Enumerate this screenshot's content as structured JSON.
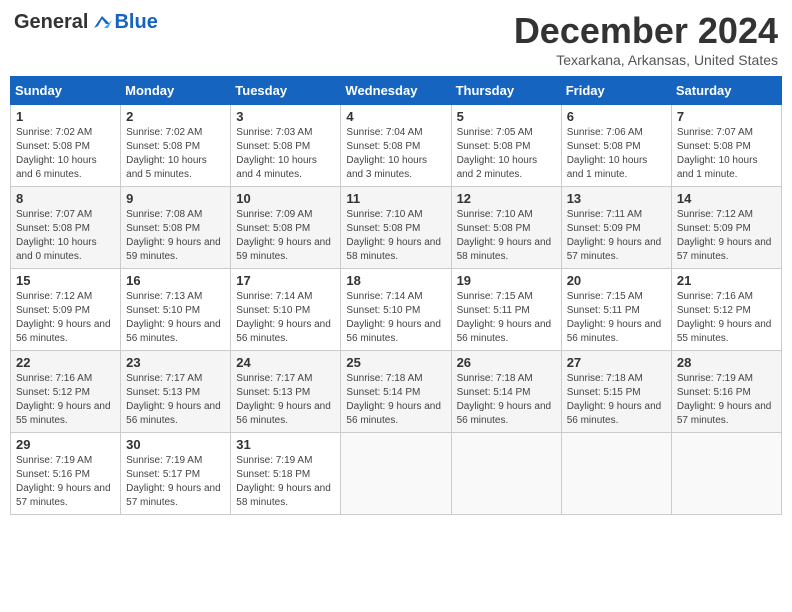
{
  "header": {
    "logo_general": "General",
    "logo_blue": "Blue",
    "title": "December 2024",
    "location": "Texarkana, Arkansas, United States"
  },
  "days_of_week": [
    "Sunday",
    "Monday",
    "Tuesday",
    "Wednesday",
    "Thursday",
    "Friday",
    "Saturday"
  ],
  "weeks": [
    [
      {
        "day": "1",
        "sunrise": "7:02 AM",
        "sunset": "5:08 PM",
        "daylight": "10 hours and 6 minutes."
      },
      {
        "day": "2",
        "sunrise": "7:02 AM",
        "sunset": "5:08 PM",
        "daylight": "10 hours and 5 minutes."
      },
      {
        "day": "3",
        "sunrise": "7:03 AM",
        "sunset": "5:08 PM",
        "daylight": "10 hours and 4 minutes."
      },
      {
        "day": "4",
        "sunrise": "7:04 AM",
        "sunset": "5:08 PM",
        "daylight": "10 hours and 3 minutes."
      },
      {
        "day": "5",
        "sunrise": "7:05 AM",
        "sunset": "5:08 PM",
        "daylight": "10 hours and 2 minutes."
      },
      {
        "day": "6",
        "sunrise": "7:06 AM",
        "sunset": "5:08 PM",
        "daylight": "10 hours and 1 minute."
      },
      {
        "day": "7",
        "sunrise": "7:07 AM",
        "sunset": "5:08 PM",
        "daylight": "10 hours and 1 minute."
      }
    ],
    [
      {
        "day": "8",
        "sunrise": "7:07 AM",
        "sunset": "5:08 PM",
        "daylight": "10 hours and 0 minutes."
      },
      {
        "day": "9",
        "sunrise": "7:08 AM",
        "sunset": "5:08 PM",
        "daylight": "9 hours and 59 minutes."
      },
      {
        "day": "10",
        "sunrise": "7:09 AM",
        "sunset": "5:08 PM",
        "daylight": "9 hours and 59 minutes."
      },
      {
        "day": "11",
        "sunrise": "7:10 AM",
        "sunset": "5:08 PM",
        "daylight": "9 hours and 58 minutes."
      },
      {
        "day": "12",
        "sunrise": "7:10 AM",
        "sunset": "5:08 PM",
        "daylight": "9 hours and 58 minutes."
      },
      {
        "day": "13",
        "sunrise": "7:11 AM",
        "sunset": "5:09 PM",
        "daylight": "9 hours and 57 minutes."
      },
      {
        "day": "14",
        "sunrise": "7:12 AM",
        "sunset": "5:09 PM",
        "daylight": "9 hours and 57 minutes."
      }
    ],
    [
      {
        "day": "15",
        "sunrise": "7:12 AM",
        "sunset": "5:09 PM",
        "daylight": "9 hours and 56 minutes."
      },
      {
        "day": "16",
        "sunrise": "7:13 AM",
        "sunset": "5:10 PM",
        "daylight": "9 hours and 56 minutes."
      },
      {
        "day": "17",
        "sunrise": "7:14 AM",
        "sunset": "5:10 PM",
        "daylight": "9 hours and 56 minutes."
      },
      {
        "day": "18",
        "sunrise": "7:14 AM",
        "sunset": "5:10 PM",
        "daylight": "9 hours and 56 minutes."
      },
      {
        "day": "19",
        "sunrise": "7:15 AM",
        "sunset": "5:11 PM",
        "daylight": "9 hours and 56 minutes."
      },
      {
        "day": "20",
        "sunrise": "7:15 AM",
        "sunset": "5:11 PM",
        "daylight": "9 hours and 56 minutes."
      },
      {
        "day": "21",
        "sunrise": "7:16 AM",
        "sunset": "5:12 PM",
        "daylight": "9 hours and 55 minutes."
      }
    ],
    [
      {
        "day": "22",
        "sunrise": "7:16 AM",
        "sunset": "5:12 PM",
        "daylight": "9 hours and 55 minutes."
      },
      {
        "day": "23",
        "sunrise": "7:17 AM",
        "sunset": "5:13 PM",
        "daylight": "9 hours and 56 minutes."
      },
      {
        "day": "24",
        "sunrise": "7:17 AM",
        "sunset": "5:13 PM",
        "daylight": "9 hours and 56 minutes."
      },
      {
        "day": "25",
        "sunrise": "7:18 AM",
        "sunset": "5:14 PM",
        "daylight": "9 hours and 56 minutes."
      },
      {
        "day": "26",
        "sunrise": "7:18 AM",
        "sunset": "5:14 PM",
        "daylight": "9 hours and 56 minutes."
      },
      {
        "day": "27",
        "sunrise": "7:18 AM",
        "sunset": "5:15 PM",
        "daylight": "9 hours and 56 minutes."
      },
      {
        "day": "28",
        "sunrise": "7:19 AM",
        "sunset": "5:16 PM",
        "daylight": "9 hours and 57 minutes."
      }
    ],
    [
      {
        "day": "29",
        "sunrise": "7:19 AM",
        "sunset": "5:16 PM",
        "daylight": "9 hours and 57 minutes."
      },
      {
        "day": "30",
        "sunrise": "7:19 AM",
        "sunset": "5:17 PM",
        "daylight": "9 hours and 57 minutes."
      },
      {
        "day": "31",
        "sunrise": "7:19 AM",
        "sunset": "5:18 PM",
        "daylight": "9 hours and 58 minutes."
      },
      null,
      null,
      null,
      null
    ]
  ]
}
